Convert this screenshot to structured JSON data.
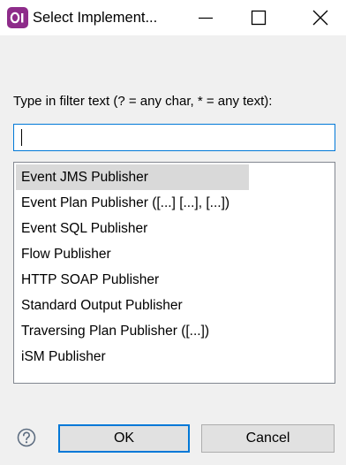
{
  "window": {
    "title": "Select Implement..."
  },
  "filter": {
    "label": "Type in filter text (? = any char, * = any text):",
    "value": ""
  },
  "list": {
    "items": [
      {
        "label": "Event JMS Publisher",
        "selected": true
      },
      {
        "label": "Event Plan Publisher ([...] [...], [...])",
        "selected": false
      },
      {
        "label": "Event SQL Publisher",
        "selected": false
      },
      {
        "label": "Flow Publisher",
        "selected": false
      },
      {
        "label": "HTTP SOAP Publisher",
        "selected": false
      },
      {
        "label": "Standard Output Publisher",
        "selected": false
      },
      {
        "label": "Traversing Plan Publisher ([...])",
        "selected": false
      },
      {
        "label": "iSM Publisher",
        "selected": false
      }
    ]
  },
  "buttons": {
    "ok": "OK",
    "cancel": "Cancel"
  },
  "colors": {
    "accent": "#0078d7",
    "app_icon": "#8e2c8a",
    "selection": "#d9d9d9",
    "dialog_bg": "#f0f0f0"
  },
  "icons": {
    "app": "app-logo-icon",
    "minimize": "minimize-icon",
    "maximize": "maximize-icon",
    "close": "close-icon",
    "help": "help-icon"
  }
}
